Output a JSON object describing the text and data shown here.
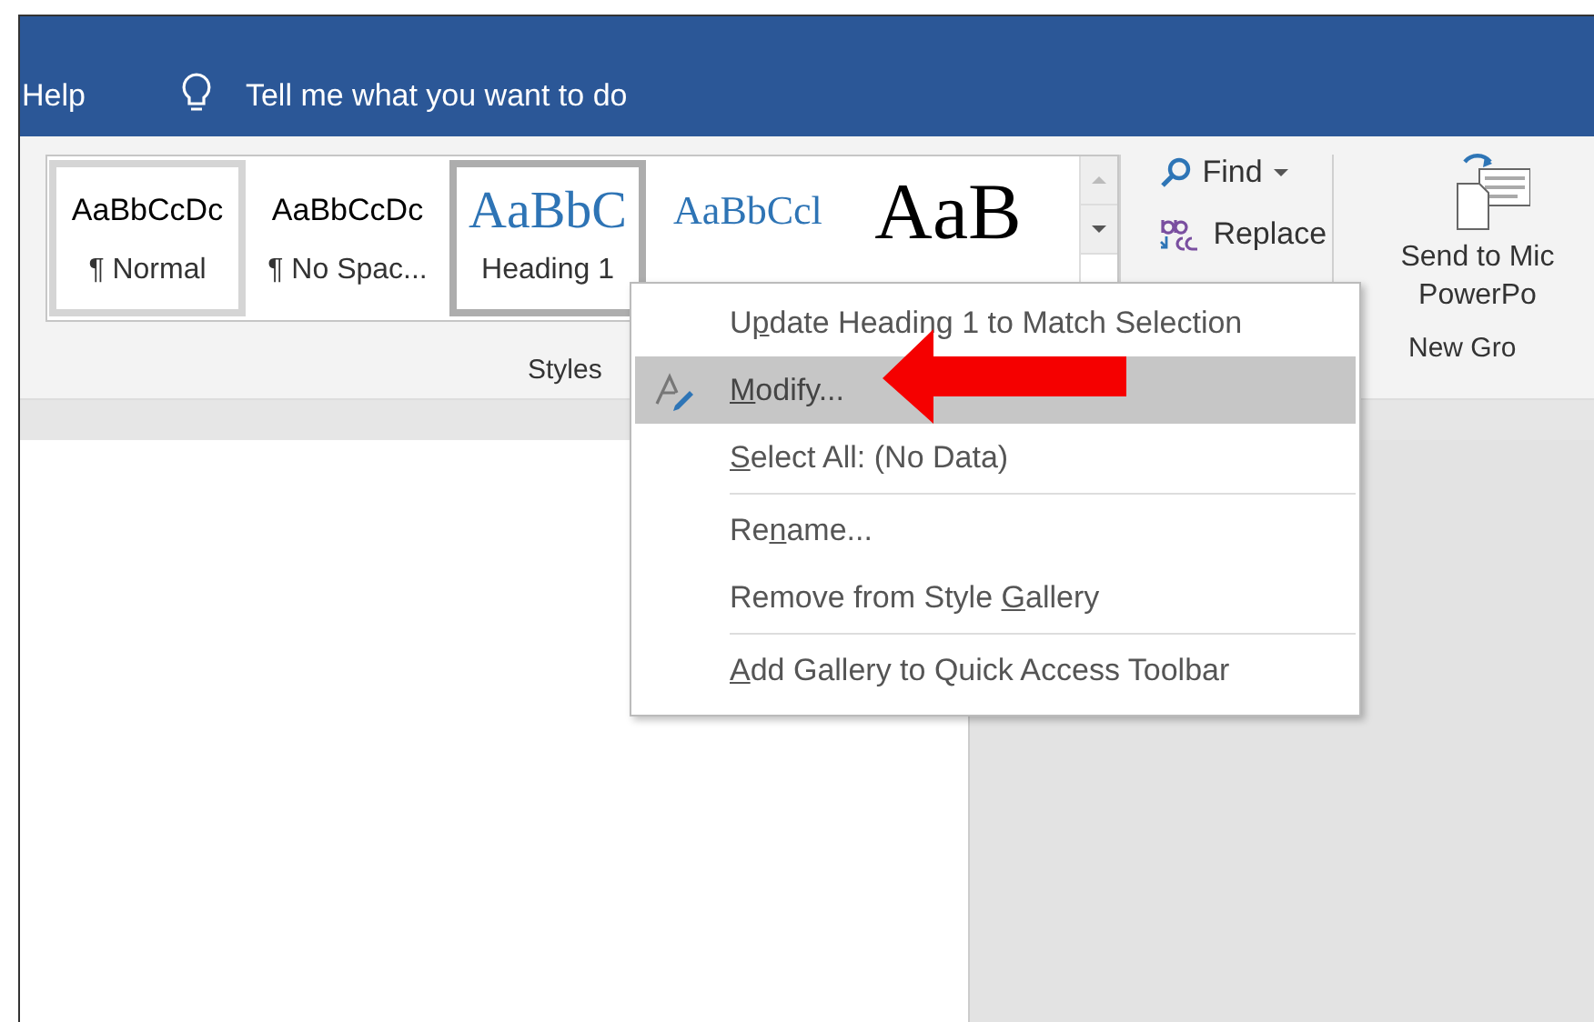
{
  "tab_bar": {
    "help_tab": "Help",
    "tell_me": "Tell me what you want to do"
  },
  "styles_gallery": {
    "items": [
      {
        "sample": "AaBbCcDc",
        "label": "¶ Normal",
        "kind": "body",
        "selected": false
      },
      {
        "sample": "AaBbCcDc",
        "label": "¶ No Spac...",
        "kind": "body",
        "selected": false
      },
      {
        "sample": "AaBbC",
        "label": "Heading 1",
        "kind": "heading1",
        "selected": true
      },
      {
        "sample": "AaBbCcl",
        "kind": "heading2",
        "selected": false
      },
      {
        "sample": "AaB",
        "kind": "title",
        "selected": false
      }
    ],
    "group_label": "Styles"
  },
  "editing": {
    "find": "Find",
    "replace": "Replace"
  },
  "new_group": {
    "line_1": "Send to Mic",
    "line_2": "PowerPo",
    "group_label": "New Gro"
  },
  "context_menu": [
    {
      "kind": "item",
      "label": {
        "before": "U",
        "key": "p",
        "after": "date Heading 1 to Match Selection"
      },
      "selected": false
    },
    {
      "kind": "item",
      "label": {
        "key": "M",
        "after": "odify..."
      },
      "selected": true,
      "has_icon": true
    },
    {
      "kind": "item",
      "label": {
        "key": "S",
        "after": "elect All: (No Data)"
      },
      "selected": false
    },
    {
      "kind": "separator"
    },
    {
      "kind": "item",
      "label": {
        "before": "Re",
        "key": "n",
        "after": "ame..."
      },
      "selected": false
    },
    {
      "kind": "item",
      "label": {
        "before": "Remove from Style ",
        "key": "G",
        "after": "allery"
      },
      "selected": false
    },
    {
      "kind": "separator"
    },
    {
      "kind": "item",
      "label": {
        "key": "A",
        "after": "dd Gallery to Quick Access Toolbar"
      },
      "selected": false
    }
  ]
}
